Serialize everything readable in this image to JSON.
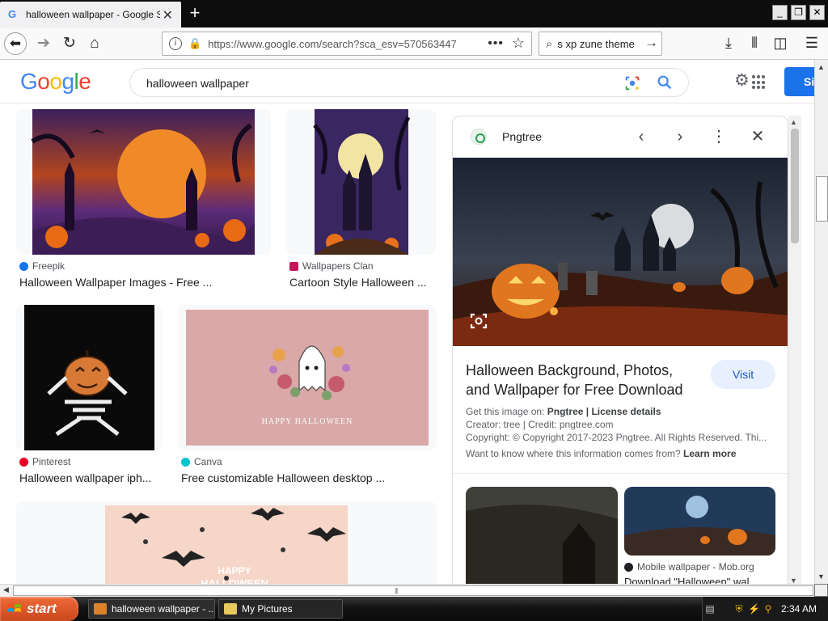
{
  "browser": {
    "tab_title": "halloween wallpaper - Google Search",
    "tab_favicon": "G",
    "new_tab": "+",
    "url": "https://www.google.com/search?sca_esv=570563447",
    "search_query": "s xp zune theme",
    "window_buttons": [
      "_",
      "❐",
      "✕"
    ],
    "icons": [
      "back-arrow-icon",
      "forward-arrow-icon",
      "reload-icon",
      "home-icon",
      "download-icon",
      "library-icon",
      "sidebar-icon",
      "menu-icon"
    ]
  },
  "google": {
    "logo": [
      "G",
      "o",
      "o",
      "g",
      "l",
      "e"
    ],
    "logo_colors": [
      "#4285F4",
      "#EA4335",
      "#FBBC05",
      "#4285F4",
      "#34A853",
      "#EA4335"
    ],
    "query": "halloween wallpaper",
    "signin_label": "Si"
  },
  "results": [
    {
      "source": "Freepik",
      "source_color": "#1273eb",
      "caption": "Halloween Wallpaper Images - Free ..."
    },
    {
      "source": "Wallpapers Clan",
      "source_color": "#c2185b",
      "caption": "Cartoon Style Halloween ..."
    },
    {
      "source": "Pinterest",
      "source_color": "#e60023",
      "caption": "Halloween wallpaper iph..."
    },
    {
      "source": "Canva",
      "source_color": "#00c4cc",
      "caption": "Free customizable Halloween desktop ..."
    }
  ],
  "thumb_texts": {
    "happy_halloween": "HAPPY HALLOWEEN",
    "happy": "HAPPY",
    "halloween": "HALLOWEEN"
  },
  "panel": {
    "source": "Pngtree",
    "title": "Halloween Background, Photos, and Wallpaper for Free Download",
    "visit_label": "Visit",
    "get_image_prefix": "Get this image on:",
    "get_image_source": "Pngtree",
    "license_label": "License details",
    "creator": "Creator: tree | Credit: pngtree.com",
    "copyright": "Copyright: © Copyright 2017-2023 Pngtree. All Rights Reserved. Thi...",
    "learn_prefix": "Want to know where this information comes from?",
    "learn_more": "Learn more",
    "related_source": "Mobile wallpaper - Mob.org",
    "related_caption": "Download \"Halloween\" wal..."
  },
  "taskbar": {
    "start_label": "start",
    "tasks": [
      "halloween wallpaper - ...",
      "My Pictures"
    ],
    "clock": "2:34 AM"
  }
}
